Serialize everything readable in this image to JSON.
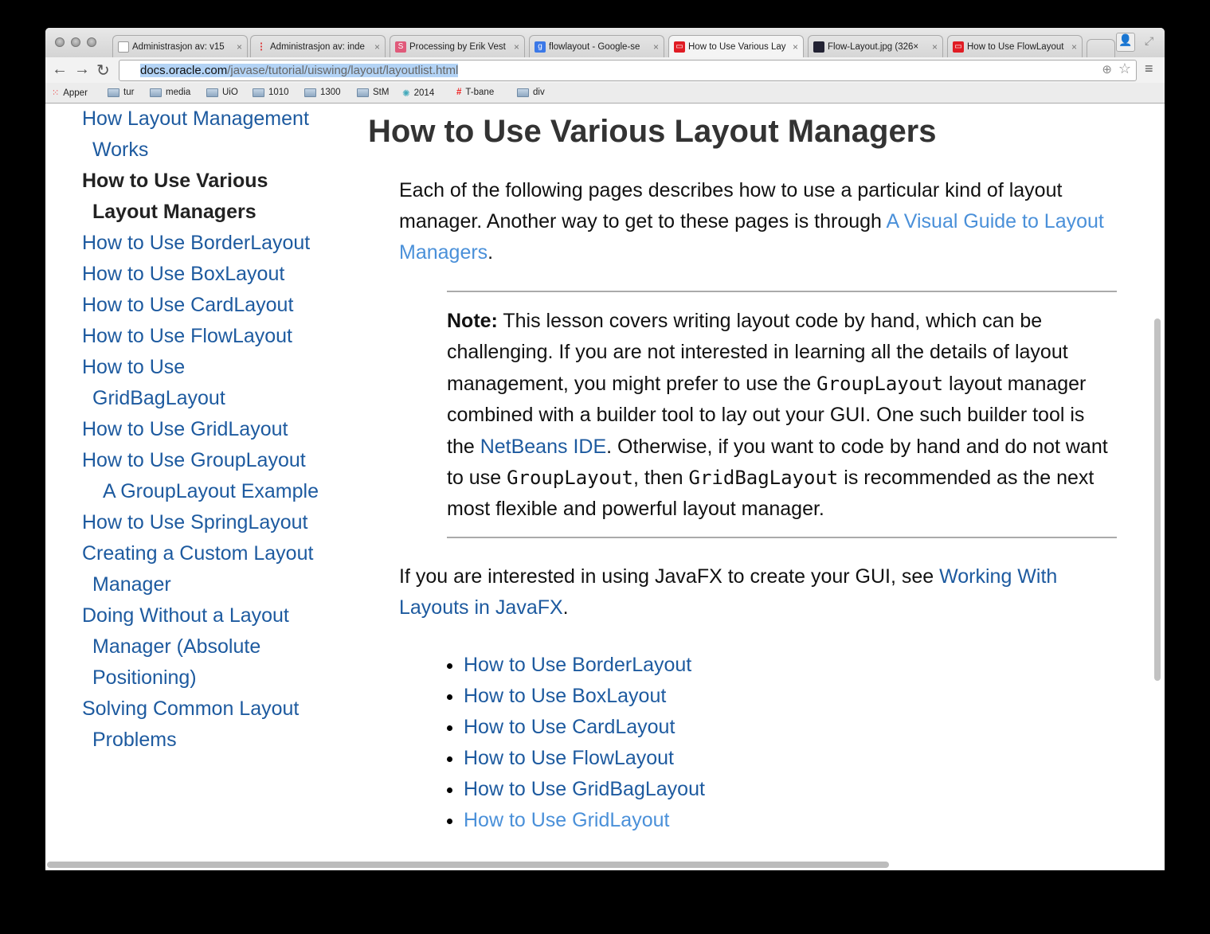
{
  "browser": {
    "tabs": [
      {
        "title": "Administrasjon av: v15",
        "icon": "page-icon",
        "active": false
      },
      {
        "title": "Administrasjon av: inde",
        "icon": "red-dot-icon",
        "active": false
      },
      {
        "title": "Processing by Erik Vest",
        "icon": "s-logo-icon",
        "active": false
      },
      {
        "title": "flowlayout - Google-se",
        "icon": "google-icon",
        "active": false
      },
      {
        "title": "How to Use Various Lay",
        "icon": "oracle-icon",
        "active": true
      },
      {
        "title": "Flow-Layout.jpg (326×",
        "icon": "image-icon",
        "active": false
      },
      {
        "title": "How to Use FlowLayout",
        "icon": "oracle-icon",
        "active": false
      }
    ],
    "url_host": "docs.oracle.com",
    "url_path": "/javase/tutorial/uiswing/layout/layoutlist.html",
    "bookmarks": [
      "Apper",
      "tur",
      "media",
      "UiO",
      "1010",
      "1300",
      "StM",
      "2014",
      "T-bane",
      "div"
    ]
  },
  "sidebar": {
    "items": [
      {
        "label": "How Layout Management Works"
      },
      {
        "label": "How to Use Various Layout Managers"
      },
      {
        "label": "How to Use BorderLayout"
      },
      {
        "label": "How to Use BoxLayout"
      },
      {
        "label": "How to Use CardLayout"
      },
      {
        "label": "How to Use FlowLayout"
      },
      {
        "label": "How to Use GridBagLayout"
      },
      {
        "label": "How to Use GridLayout"
      },
      {
        "label": "How to Use GroupLayout"
      },
      {
        "label": "A GroupLayout Example"
      },
      {
        "label": "How to Use SpringLayout"
      },
      {
        "label": "Creating a Custom Layout Manager"
      },
      {
        "label": "Doing Without a Layout Manager (Absolute Positioning)"
      },
      {
        "label": "Solving Common Layout Problems"
      }
    ]
  },
  "main": {
    "title": "How to Use Various Layout Managers",
    "intro_1": "Each of the following pages describes how to use a particular kind of layout manager. Another way to get to these pages is through ",
    "intro_link": "A Visual Guide to Layout Managers",
    "intro_2": ".",
    "note_label": "Note:",
    "note_1": " This lesson covers writing layout code by hand, which can be challenging. If you are not interested in learning all the details of layout management, you might prefer to use the ",
    "note_code1": "GroupLayout",
    "note_2": " layout manager combined with a builder tool to lay out your GUI. One such builder tool is the ",
    "note_link": "NetBeans IDE",
    "note_3": ". Otherwise, if you want to code by hand and do not want to use ",
    "note_code2": "GroupLayout",
    "note_4": ", then ",
    "note_code3": "GridBagLayout",
    "note_5": " is recommended as the next most flexible and powerful layout manager.",
    "javafx_1": "If you are interested in using JavaFX to create your GUI, see ",
    "javafx_link": "Working With Layouts in JavaFX",
    "javafx_2": ".",
    "list": [
      "How to Use BorderLayout",
      "How to Use BoxLayout",
      "How to Use CardLayout",
      "How to Use FlowLayout",
      "How to Use GridBagLayout",
      "How to Use GridLayout"
    ]
  },
  "colors": {
    "link": "#1d5a9f",
    "visited_link": "#4a90d9",
    "text": "#111111"
  }
}
